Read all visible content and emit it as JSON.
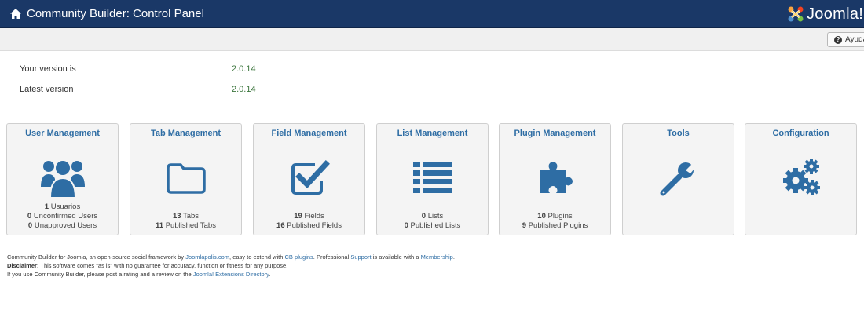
{
  "header": {
    "title": "Community Builder: Control Panel",
    "brand_text": "Joomla!"
  },
  "toolbar": {
    "help_label": "Ayuda"
  },
  "versions": {
    "current_label": "Your version is",
    "current_value": "2.0.14",
    "latest_label": "Latest version",
    "latest_value": "2.0.14"
  },
  "tiles": [
    {
      "title": "User Management",
      "icon": "users-icon",
      "stats": [
        {
          "num": "1",
          "label": "Usuarios"
        },
        {
          "num": "0",
          "label": "Unconfirmed Users"
        },
        {
          "num": "0",
          "label": "Unapproved Users"
        }
      ]
    },
    {
      "title": "Tab Management",
      "icon": "folder-icon",
      "stats": [
        {
          "num": "13",
          "label": "Tabs"
        },
        {
          "num": "11",
          "label": "Published Tabs"
        }
      ]
    },
    {
      "title": "Field Management",
      "icon": "checkbox-icon",
      "stats": [
        {
          "num": "19",
          "label": "Fields"
        },
        {
          "num": "16",
          "label": "Published Fields"
        }
      ]
    },
    {
      "title": "List Management",
      "icon": "list-icon",
      "stats": [
        {
          "num": "0",
          "label": "Lists"
        },
        {
          "num": "0",
          "label": "Published Lists"
        }
      ]
    },
    {
      "title": "Plugin Management",
      "icon": "puzzle-icon",
      "stats": [
        {
          "num": "10",
          "label": "Plugins"
        },
        {
          "num": "9",
          "label": "Published Plugins"
        }
      ]
    },
    {
      "title": "Tools",
      "icon": "wrench-icon",
      "stats": []
    },
    {
      "title": "Configuration",
      "icon": "gears-icon",
      "stats": []
    }
  ],
  "footer": {
    "l1_a": "Community Builder for Joomla, an open-source social framework by ",
    "l1_link1": "Joomlapolis.com",
    "l1_b": ", easy to extend with ",
    "l1_link2": "CB plugins",
    "l1_c": ". Professional ",
    "l1_link3": "Support",
    "l1_d": " is available with a ",
    "l1_link4": "Membership",
    "l1_e": ".",
    "l2_bold": "Disclaimer:",
    "l2_text": " This software comes \"as is\" with no guarantee for accuracy, function or fitness for any purpose.",
    "l3_a": "If you use Community Builder, please post a rating and a review on the ",
    "l3_link": "Joomla! Extensions Directory",
    "l3_b": "."
  },
  "colors": {
    "header_bg": "#1a3867",
    "accent_blue": "#2e6da4",
    "version_green": "#3c763d"
  }
}
